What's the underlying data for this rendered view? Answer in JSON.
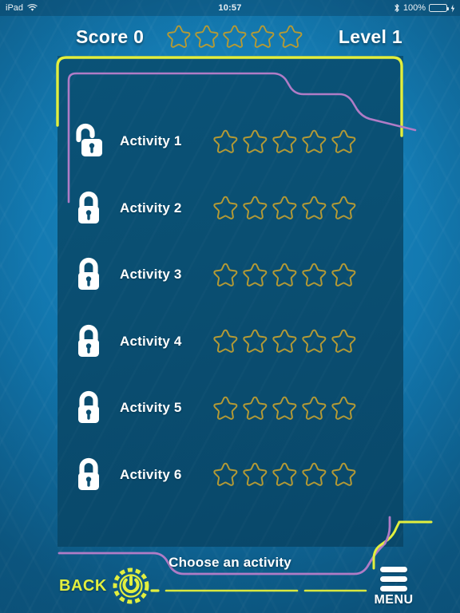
{
  "status_bar": {
    "device": "iPad",
    "wifi_icon": "wifi-icon",
    "time": "10:57",
    "bluetooth_icon": "bluetooth-icon",
    "battery_percent": "100%",
    "battery_icon": "battery-full-charging-icon"
  },
  "hud": {
    "score_label": "Score 0",
    "level_label": "Level 1",
    "stars_total": 5,
    "stars_filled": 0
  },
  "panel": {
    "outer_border_color": "#e2ef3e",
    "inner_border_color": "#b07cc6",
    "background_color": "#0a4f72"
  },
  "activities": [
    {
      "label": "Activity 1",
      "locked": false,
      "lock_icon": "unlock-icon",
      "stars_total": 5,
      "stars_filled": 0
    },
    {
      "label": "Activity 2",
      "locked": true,
      "lock_icon": "lock-icon",
      "stars_total": 5,
      "stars_filled": 0
    },
    {
      "label": "Activity 3",
      "locked": true,
      "lock_icon": "lock-icon",
      "stars_total": 5,
      "stars_filled": 0
    },
    {
      "label": "Activity 4",
      "locked": true,
      "lock_icon": "lock-icon",
      "stars_total": 5,
      "stars_filled": 0
    },
    {
      "label": "Activity 5",
      "locked": true,
      "lock_icon": "lock-icon",
      "stars_total": 5,
      "stars_filled": 0
    },
    {
      "label": "Activity 6",
      "locked": true,
      "lock_icon": "lock-icon",
      "stars_total": 5,
      "stars_filled": 0
    }
  ],
  "footer": {
    "back_label": "BACK",
    "back_icon": "power-button-icon",
    "hint_text": "Choose an activity",
    "menu_label": "MENU",
    "menu_icon": "hamburger-menu-icon"
  },
  "colors": {
    "accent_yellow": "#e2ef3e",
    "accent_purple": "#b07cc6",
    "star_gold": "#b49a35",
    "background_blue": "#1276ad",
    "panel_teal": "#0a4f72"
  }
}
